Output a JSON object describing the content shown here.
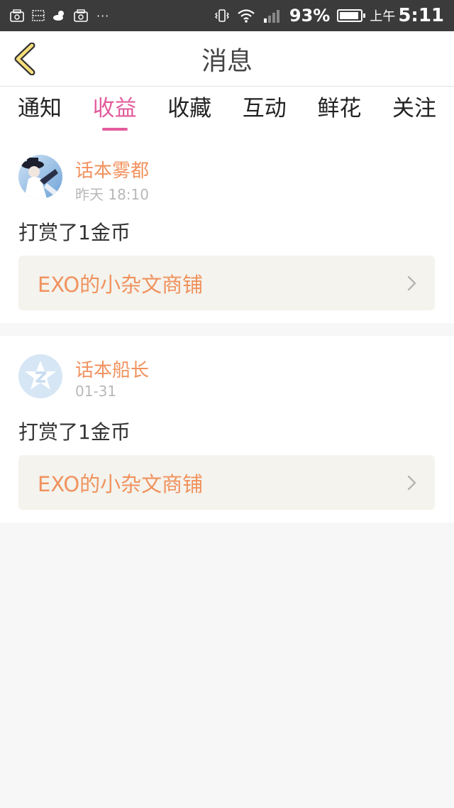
{
  "status_bar": {
    "battery_pct": "93%",
    "ampm": "上午",
    "time": "5:11",
    "dots": "···"
  },
  "header": {
    "title": "消息"
  },
  "tabs": [
    {
      "label": "通知",
      "active": false
    },
    {
      "label": "收益",
      "active": true
    },
    {
      "label": "收藏",
      "active": false
    },
    {
      "label": "互动",
      "active": false
    },
    {
      "label": "鲜花",
      "active": false
    },
    {
      "label": "关注",
      "active": false
    }
  ],
  "messages": [
    {
      "user": "话本雾都",
      "time": "昨天 18:10",
      "text": "打赏了1金币",
      "link": "EXO的小杂文商铺"
    },
    {
      "user": "话本船长",
      "time": "01-31",
      "text": "打赏了1金币",
      "link": "EXO的小杂文商铺"
    }
  ],
  "colors": {
    "accent": "#e25c9c",
    "orange": "#f0925e",
    "status_bar_bg": "#3b3b3b"
  }
}
